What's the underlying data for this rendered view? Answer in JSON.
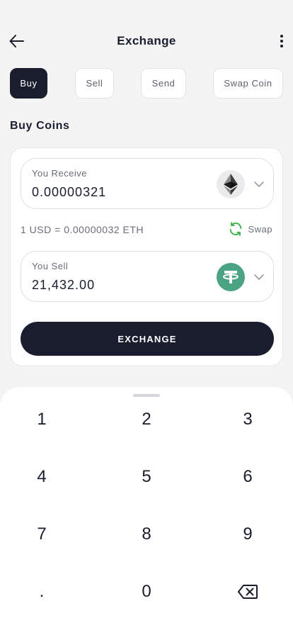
{
  "header": {
    "title": "Exchange"
  },
  "tabs": [
    {
      "label": "Buy",
      "active": true
    },
    {
      "label": "Sell",
      "active": false
    },
    {
      "label": "Send",
      "active": false
    },
    {
      "label": "Swap Coin",
      "active": false
    }
  ],
  "section_title": "Buy Coins",
  "receive": {
    "label": "You Receive",
    "value": "0.00000321",
    "coin_icon": "ethereum-icon"
  },
  "rate": {
    "text": "1 USD = 0.00000032 ETH",
    "swap_label": "Swap"
  },
  "sell": {
    "label": "You Sell",
    "value": "21,432.00",
    "coin_icon": "tether-icon"
  },
  "exchange_button": "EXCHANGE",
  "keypad": {
    "keys": [
      "1",
      "2",
      "3",
      "4",
      "5",
      "6",
      "7",
      "8",
      "9",
      ".",
      "0"
    ],
    "backspace_icon": "backspace-icon"
  },
  "colors": {
    "primary": "#1a1d2e",
    "background": "#f4f4f5",
    "tether": "#4aa382",
    "swap_icon": "#3cb043"
  }
}
